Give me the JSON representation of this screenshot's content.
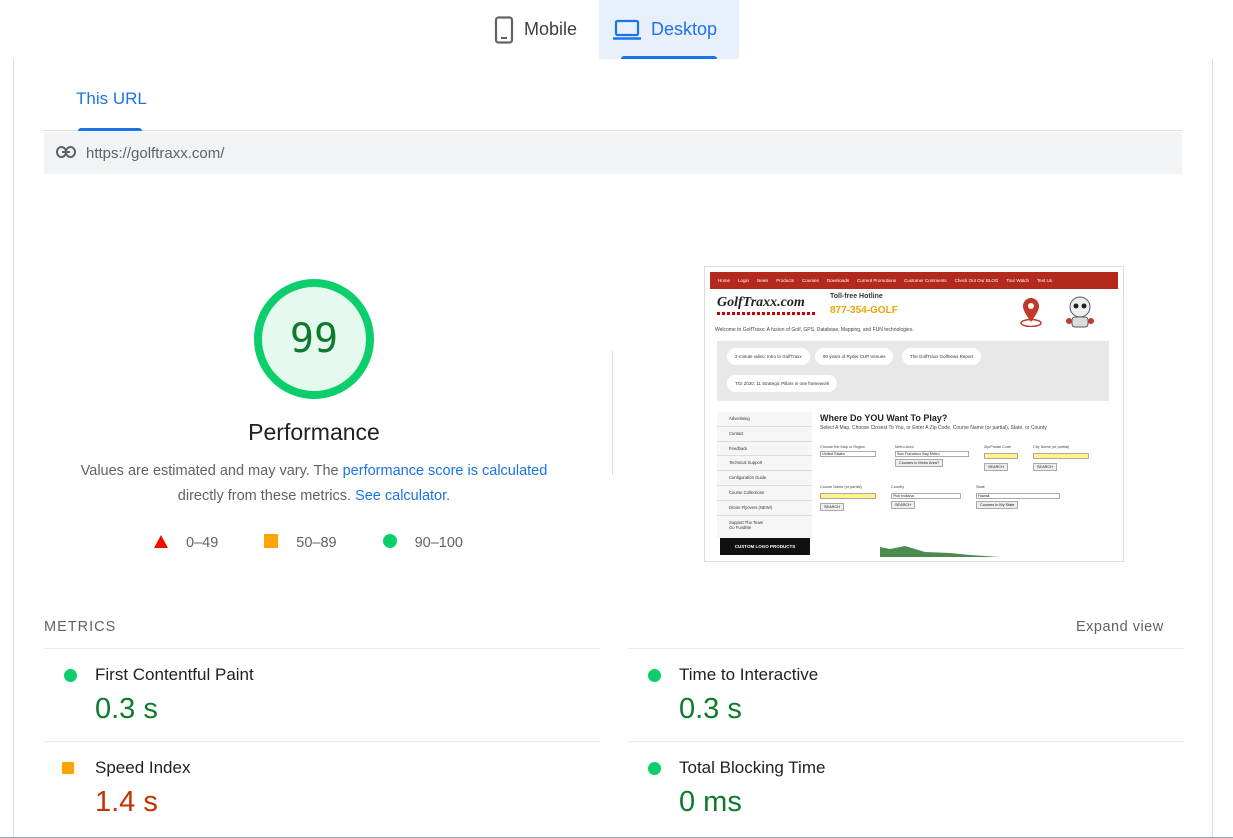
{
  "device_tabs": [
    {
      "label": "Mobile",
      "icon": "smartphone-icon",
      "active": false
    },
    {
      "label": "Desktop",
      "icon": "laptop-icon",
      "active": true
    }
  ],
  "url_tab": {
    "label": "This URL"
  },
  "url": {
    "icon": "link-icon",
    "value": "https://golftraxx.com/"
  },
  "gauge": {
    "score": "99",
    "score_fraction": 0.99,
    "title": "Performance",
    "desc_text1": "Values are estimated and may vary. The ",
    "desc_link1": "performance score is calculated",
    "desc_text2": " directly from these metrics. ",
    "desc_link2": "See calculator",
    "desc_text3": "."
  },
  "legend": [
    {
      "icon": "fail-triangle-icon",
      "label": "0–49",
      "color": "#eb0f00"
    },
    {
      "icon": "average-square-icon",
      "label": "50–89",
      "color": "#ffa400"
    },
    {
      "icon": "pass-circle-icon",
      "label": "90–100",
      "color": "#0cce6b"
    }
  ],
  "colors": {
    "pass": "#0cce6b",
    "pass_text": "#0d7a2c",
    "average": "#ffa400",
    "average_text": "#c33300",
    "fail": "#eb0f00",
    "accent": "#1a73e8"
  },
  "screenshot": {
    "nav_items": [
      "Home",
      "Login",
      "News",
      "Products",
      "Courses",
      "Downloads",
      "Current Promotions",
      "Customer Comments",
      "Check Out Our BLOG",
      "Tour Watch",
      "Text Us"
    ],
    "logo": "GolfTraxx.com",
    "hotline": "Toll-free Hotline",
    "phone": "877-354-GOLF",
    "welcome": "Welcome to GolfTraxx: A fusion of Golf, GPS, Database, Mapping, and FUN technologies.",
    "pills": [
      "2-minute video: Intro to GolfTraxx",
      "90 years of Ryder CUP Venues",
      "The GolfTraxx Golfnews Report",
      "TGI 2020: 11 Strategic Pillars in one framework"
    ],
    "side_items": [
      "Advertising",
      "Contact",
      "Feedback",
      "Technical Support",
      "Configuration Guide",
      "Course Collections",
      "Drone Flyovers (NEW!)",
      "Support The Team",
      "Go FundMe"
    ],
    "side_button": "CUSTOM LOGO PRODUCTS",
    "heading": "Where Do YOU Want To Play?",
    "subheading": "Select A Map, Choose Closest To You, or Enter A Zip Code, Course Name (or partial), State, or County",
    "f_map_label": "Choose the Map or Region",
    "f_map_value": "United States",
    "f_metro_label": "Metro Area",
    "f_metro_value": "San Francisco Bay Metro",
    "f_metro_btn": "Courses In Metro Area?",
    "f_zip_label": "Zip/Postal Code",
    "f_city_label": "City Name (or partial)",
    "f_course_label": "Course Name (or partial)",
    "f_country_label": "Country",
    "f_country_value": "Pick Indiana",
    "f_state_label": "State",
    "f_state_value": "Hawaii",
    "f_state_btn": "Courses In My State",
    "search": "SEARCH"
  },
  "metrics": {
    "header": "METRICS",
    "expand": "Expand view",
    "items": [
      {
        "name": "First Contentful Paint",
        "value": "0.3 s",
        "status": "pass",
        "icon": "pass-circle-icon"
      },
      {
        "name": "Time to Interactive",
        "value": "0.3 s",
        "status": "pass",
        "icon": "pass-circle-icon"
      },
      {
        "name": "Speed Index",
        "value": "1.4 s",
        "status": "avg",
        "icon": "average-square-icon"
      },
      {
        "name": "Total Blocking Time",
        "value": "0 ms",
        "status": "pass",
        "icon": "pass-circle-icon"
      }
    ]
  }
}
